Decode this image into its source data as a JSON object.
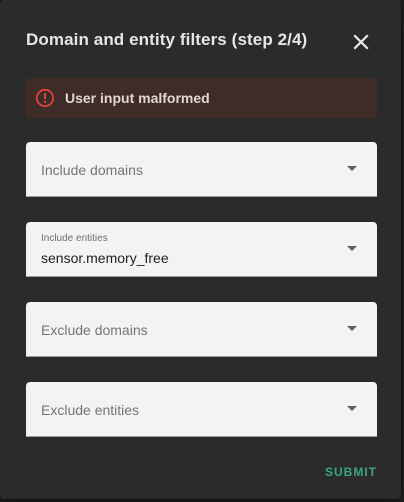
{
  "dialog": {
    "title": "Domain and entity filters (step 2/4)",
    "close_icon": "close-icon"
  },
  "error": {
    "icon": "alert-circle-icon",
    "message": "User input malformed",
    "color": "#db4437"
  },
  "fields": {
    "include_domains": {
      "placeholder": "Include domains",
      "value": ""
    },
    "include_entities": {
      "label": "Include entities",
      "value": "sensor.memory_free"
    },
    "exclude_domains": {
      "placeholder": "Exclude domains",
      "value": ""
    },
    "exclude_entities": {
      "placeholder": "Exclude entities",
      "value": ""
    }
  },
  "actions": {
    "submit_label": "SUBMIT"
  },
  "colors": {
    "accent": "#3aa583",
    "dialog_bg": "#2b2b2b",
    "field_bg": "#f3f3f3"
  }
}
